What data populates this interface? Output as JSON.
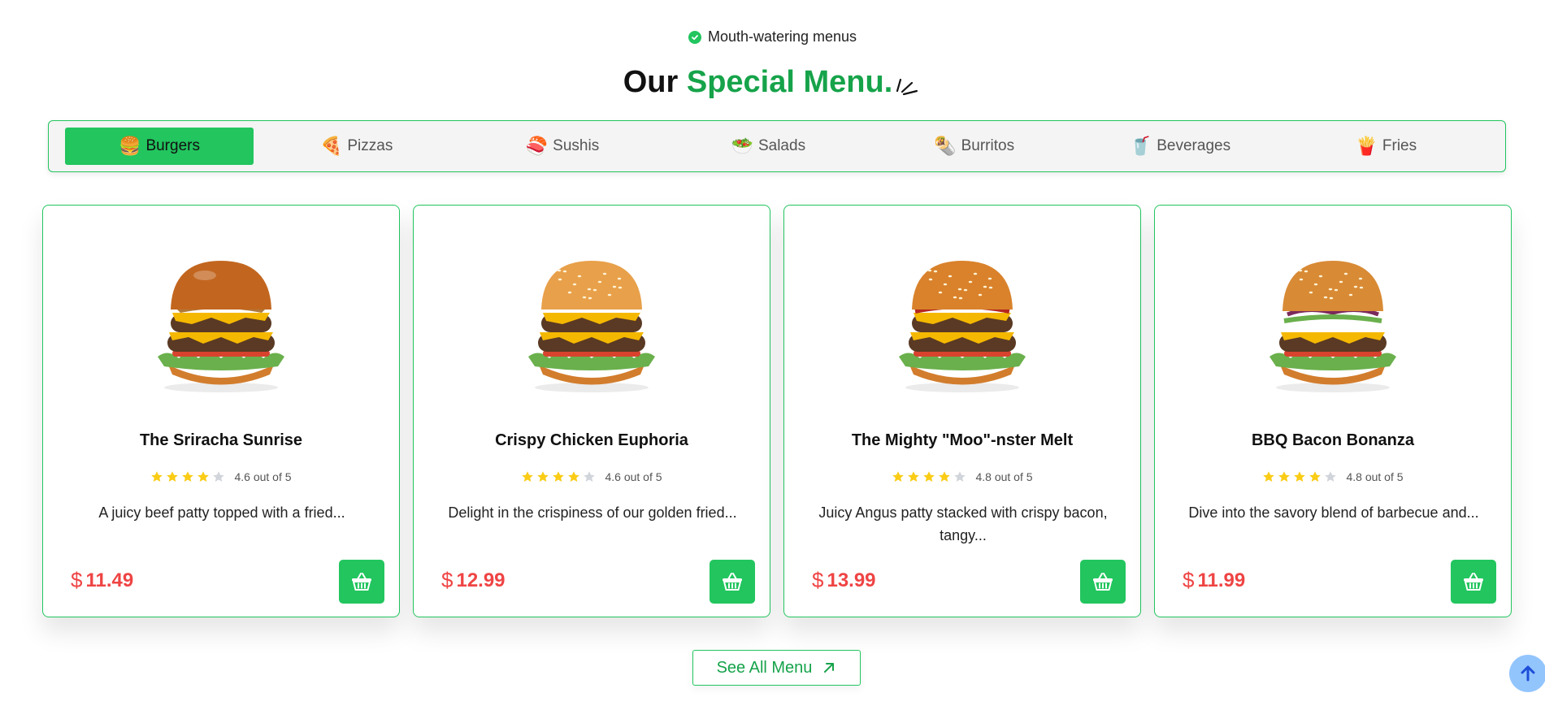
{
  "header": {
    "eyebrow": "Mouth-watering menus",
    "title_plain": "Our",
    "title_accent": "Special Menu."
  },
  "colors": {
    "accent": "#22c55e",
    "accent_text": "#16a34a",
    "price": "#ef4444",
    "star_filled": "#facc15",
    "star_empty": "#d1d5db",
    "scroll_button": "#93c5fd"
  },
  "tabs": [
    {
      "label": "Burgers",
      "icon": "burger-icon",
      "glyph": "🍔",
      "active": true
    },
    {
      "label": "Pizzas",
      "icon": "pizza-icon",
      "glyph": "🍕",
      "active": false
    },
    {
      "label": "Sushis",
      "icon": "sushi-icon",
      "glyph": "🍣",
      "active": false
    },
    {
      "label": "Salads",
      "icon": "salad-icon",
      "glyph": "🥗",
      "active": false
    },
    {
      "label": "Burritos",
      "icon": "burrito-icon",
      "glyph": "🌯",
      "active": false
    },
    {
      "label": "Beverages",
      "icon": "beverage-icon",
      "glyph": "🥤",
      "active": false
    },
    {
      "label": "Fries",
      "icon": "fries-icon",
      "glyph": "🍟",
      "active": false
    }
  ],
  "menu_items": [
    {
      "name": "The Sriracha Sunrise",
      "rating": 4.6,
      "rating_text": "4.6 out of 5",
      "stars_filled": 4,
      "description": "A juicy beef patty topped with a fried...",
      "currency": "$",
      "price": "11.49"
    },
    {
      "name": "Crispy Chicken Euphoria",
      "rating": 4.6,
      "rating_text": "4.6 out of 5",
      "stars_filled": 4,
      "description": "Delight in the crispiness of our golden fried...",
      "currency": "$",
      "price": "12.99"
    },
    {
      "name": "The Mighty \"Moo\"-nster Melt",
      "rating": 4.8,
      "rating_text": "4.8 out of 5",
      "stars_filled": 4,
      "description": "Juicy Angus patty stacked with crispy bacon, tangy...",
      "currency": "$",
      "price": "13.99"
    },
    {
      "name": "BBQ Bacon Bonanza",
      "rating": 4.8,
      "rating_text": "4.8 out of 5",
      "stars_filled": 4,
      "description": "Dive into the savory blend of barbecue and...",
      "currency": "$",
      "price": "11.99"
    }
  ],
  "see_all": {
    "label": "See All Menu",
    "icon": "arrow-up-right-icon"
  },
  "scroll_top": {
    "icon": "arrow-up-icon"
  }
}
